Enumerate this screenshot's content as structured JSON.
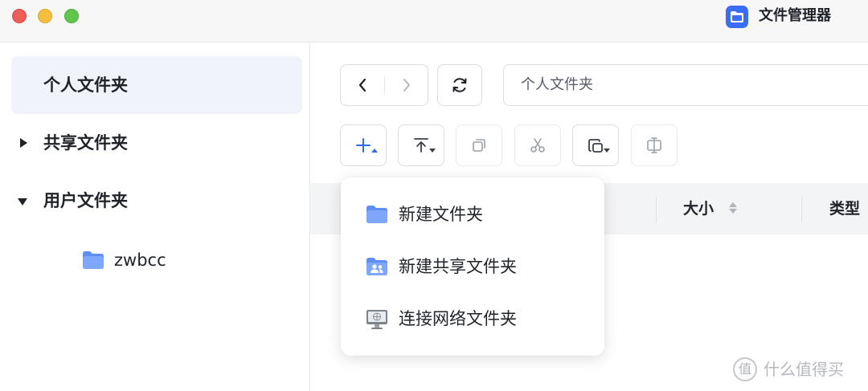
{
  "window": {
    "title": "文件管理器",
    "accent": "#3b6cf6"
  },
  "sidebar": {
    "items": [
      {
        "label": "个人文件夹",
        "selected": true
      },
      {
        "label": "共享文件夹",
        "expanded": false
      },
      {
        "label": "用户文件夹",
        "expanded": true
      }
    ],
    "children": [
      {
        "label": "zwbcc",
        "icon": "folder-icon"
      }
    ]
  },
  "toolbar": {
    "path": "个人文件夹",
    "buttons": [
      {
        "icon": "plus-icon"
      },
      {
        "icon": "upload-icon"
      },
      {
        "icon": "copy-icon",
        "disabled": true
      },
      {
        "icon": "cut-icon",
        "disabled": true
      },
      {
        "icon": "paste-icon"
      },
      {
        "icon": "rename-icon",
        "disabled": true
      }
    ]
  },
  "table": {
    "columns": [
      {
        "label": "大小"
      },
      {
        "label": "类型"
      }
    ]
  },
  "new_menu": {
    "items": [
      {
        "label": "新建文件夹",
        "icon": "folder-icon"
      },
      {
        "label": "新建共享文件夹",
        "icon": "shared-folder-icon"
      },
      {
        "label": "连接网络文件夹",
        "icon": "network-monitor-icon"
      }
    ]
  },
  "watermark": {
    "badge": "值",
    "text": "什么值得买"
  }
}
